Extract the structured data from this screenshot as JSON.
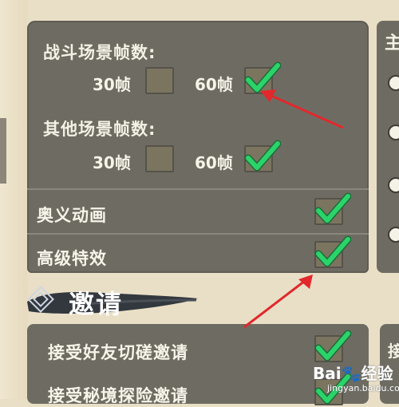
{
  "frame": {
    "battle_fps": {
      "title": "战斗场景帧数:",
      "options": [
        {
          "label": "30帧",
          "checked": false
        },
        {
          "label": "60帧",
          "checked": true
        }
      ]
    },
    "other_fps": {
      "title": "其他场景帧数:",
      "options": [
        {
          "label": "30帧",
          "checked": false
        },
        {
          "label": "60帧",
          "checked": true
        }
      ]
    },
    "toggles": [
      {
        "label": "奥义动画",
        "checked": true
      },
      {
        "label": "高级特效",
        "checked": true
      }
    ]
  },
  "right_panel": {
    "heading": "主",
    "radio_count": 4
  },
  "invite": {
    "title": "邀请",
    "right_heading": "接",
    "rows": [
      {
        "label": "接受好友切磋邀请",
        "checked": true
      },
      {
        "label": "接受秘境探险邀请",
        "checked": true
      }
    ]
  },
  "watermark": {
    "brand": "Bai🐾经验",
    "sub": "jingyan.baidu.com"
  },
  "colors": {
    "panel": "#6e6c62",
    "check_green": "#2bd46a",
    "arrow_red": "#e2282c",
    "background": "#e9dfc6"
  }
}
